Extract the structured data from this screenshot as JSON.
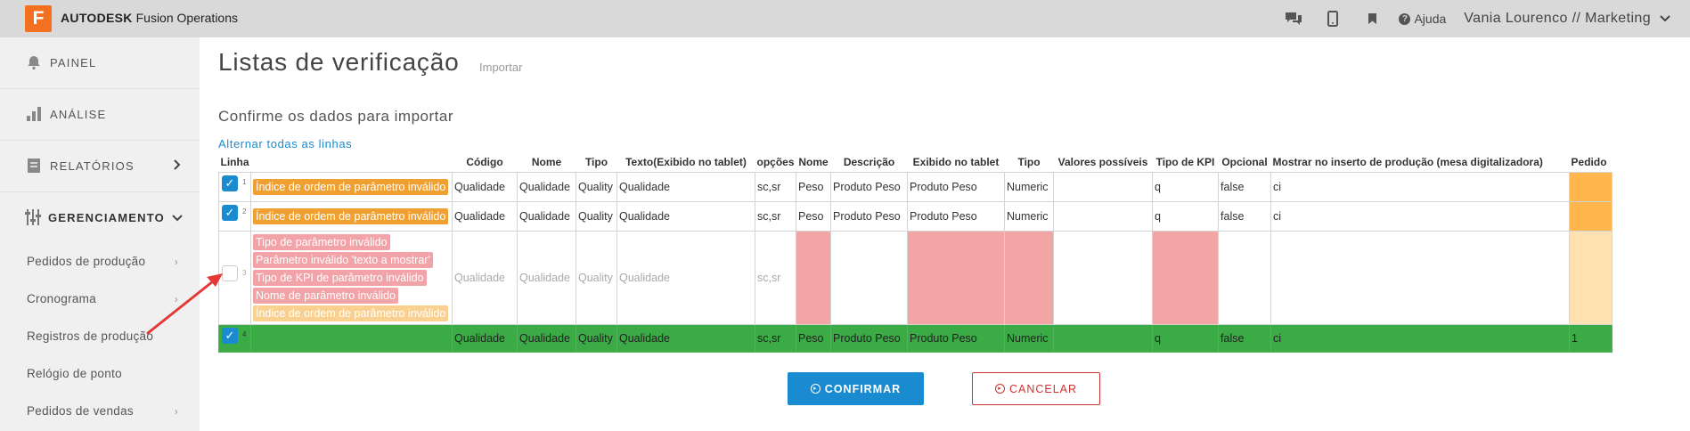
{
  "app": {
    "logo_letter": "F",
    "brand_bold": "AUTODESK",
    "brand_rest": "Fusion Operations",
    "help_label": "Ajuda",
    "user_label": "Vania Lourenco // Marketing"
  },
  "sidebar": {
    "main": [
      {
        "label": "PAINEL",
        "icon": "bell-icon"
      },
      {
        "label": "ANÁLISE",
        "icon": "bar-chart-icon"
      },
      {
        "label": "RELATÓRIOS",
        "icon": "document-icon"
      },
      {
        "label": "GERENCIAMENTO",
        "icon": "sliders-icon"
      }
    ],
    "sub": [
      {
        "label": "Pedidos de produção"
      },
      {
        "label": "Cronograma"
      },
      {
        "label": "Registros de produção"
      },
      {
        "label": "Relógio de ponto"
      },
      {
        "label": "Pedidos de vendas"
      }
    ]
  },
  "page": {
    "title": "Listas de verificação",
    "subtitle": "Importar",
    "section_title": "Confirme os dados para importar",
    "toggle_link": "Alternar todas as linhas"
  },
  "table": {
    "headers": [
      "Linha",
      "",
      "Código",
      "Nome",
      "Tipo",
      "Texto(Exibido no tablet)",
      "opções",
      "Nome",
      "Descrição",
      "Exibido no tablet",
      "Tipo",
      "Valores possíveis",
      "Tipo de KPI",
      "Opcional",
      "Mostrar no inserto de produção (mesa digitalizadora)",
      "Pedido"
    ],
    "rows": [
      {
        "num": "1",
        "errors": [
          "Índice de ordem de parâmetro inválido"
        ],
        "cells": [
          "Qualidade",
          "Qualidade",
          "Quality",
          "Qualidade",
          "sc,sr",
          "Peso",
          "Produto Peso",
          "Produto Peso",
          "Numeric",
          "",
          "q",
          "false",
          "ci",
          ""
        ]
      },
      {
        "num": "2",
        "errors": [
          "Índice de ordem de parâmetro inválido"
        ],
        "cells": [
          "Qualidade",
          "Qualidade",
          "Quality",
          "Qualidade",
          "sc,sr",
          "Peso",
          "Produto Peso",
          "Produto Peso",
          "Numeric",
          "",
          "q",
          "false",
          "ci",
          ""
        ]
      },
      {
        "num": "3",
        "errors": [
          "Tipo de parâmetro inválido",
          "Parâmetro inválido 'texto a mostrar'",
          "Tipo de KPI de parâmetro inválido",
          "Nome de parâmetro inválido",
          "Índice de ordem de parâmetro inválido"
        ],
        "cells": [
          "Qualidade",
          "Qualidade",
          "Quality",
          "Qualidade",
          "sc,sr",
          "",
          "",
          "",
          "",
          "",
          "",
          "",
          "",
          ""
        ]
      },
      {
        "num": "4",
        "errors": [],
        "cells": [
          "Qualidade",
          "Qualidade",
          "Quality",
          "Qualidade",
          "sc,sr",
          "Peso",
          "Produto Peso",
          "Produto Peso",
          "Numeric",
          "",
          "q",
          "false",
          "ci",
          "1"
        ]
      }
    ]
  },
  "buttons": {
    "confirm": "CONFIRMAR",
    "cancel": "CANCELAR"
  },
  "colors": {
    "accent": "#1a8bd0",
    "error_orange": "#f0a030",
    "error_pink": "#f2a3a8",
    "success_green": "#3aab45",
    "cancel_red": "#cc3333",
    "annotation_arrow": "#e53935"
  }
}
